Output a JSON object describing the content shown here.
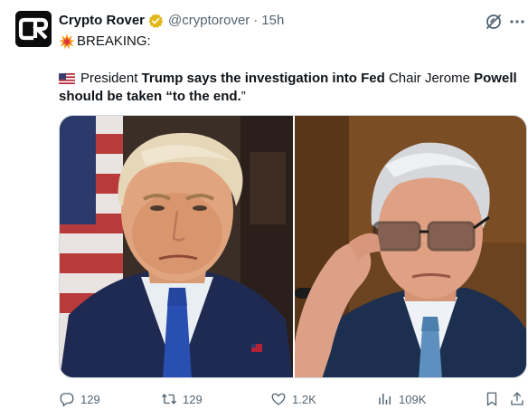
{
  "tweet": {
    "display_name": "Crypto Rover",
    "handle": "@cryptorover",
    "separator": "·",
    "time": "15h",
    "breaking": "BREAKING:",
    "text": {
      "p1": "President",
      "b1": "Trump says the investigation into Fed",
      "p2": "Chair Jerome",
      "b2": "Powell",
      "b3": "should be taken",
      "b4": "“to the end.",
      "p3": "”"
    },
    "avatar_text": "CR"
  },
  "actions": {
    "replies": "129",
    "retweets": "129",
    "likes": "1.2K",
    "views": "109K"
  },
  "colors": {
    "text_primary": "#0f1419",
    "text_secondary": "#536471",
    "verified_gold": "#e2b719",
    "border": "#cfd9de"
  },
  "icons": {
    "verified": "gold-verified-badge-icon",
    "grok": "grok-icon",
    "more": "more-options-icon",
    "reply": "reply-icon",
    "retweet": "retweet-icon",
    "like": "heart-icon",
    "views": "views-chart-icon",
    "bookmark": "bookmark-icon",
    "share": "share-icon"
  }
}
